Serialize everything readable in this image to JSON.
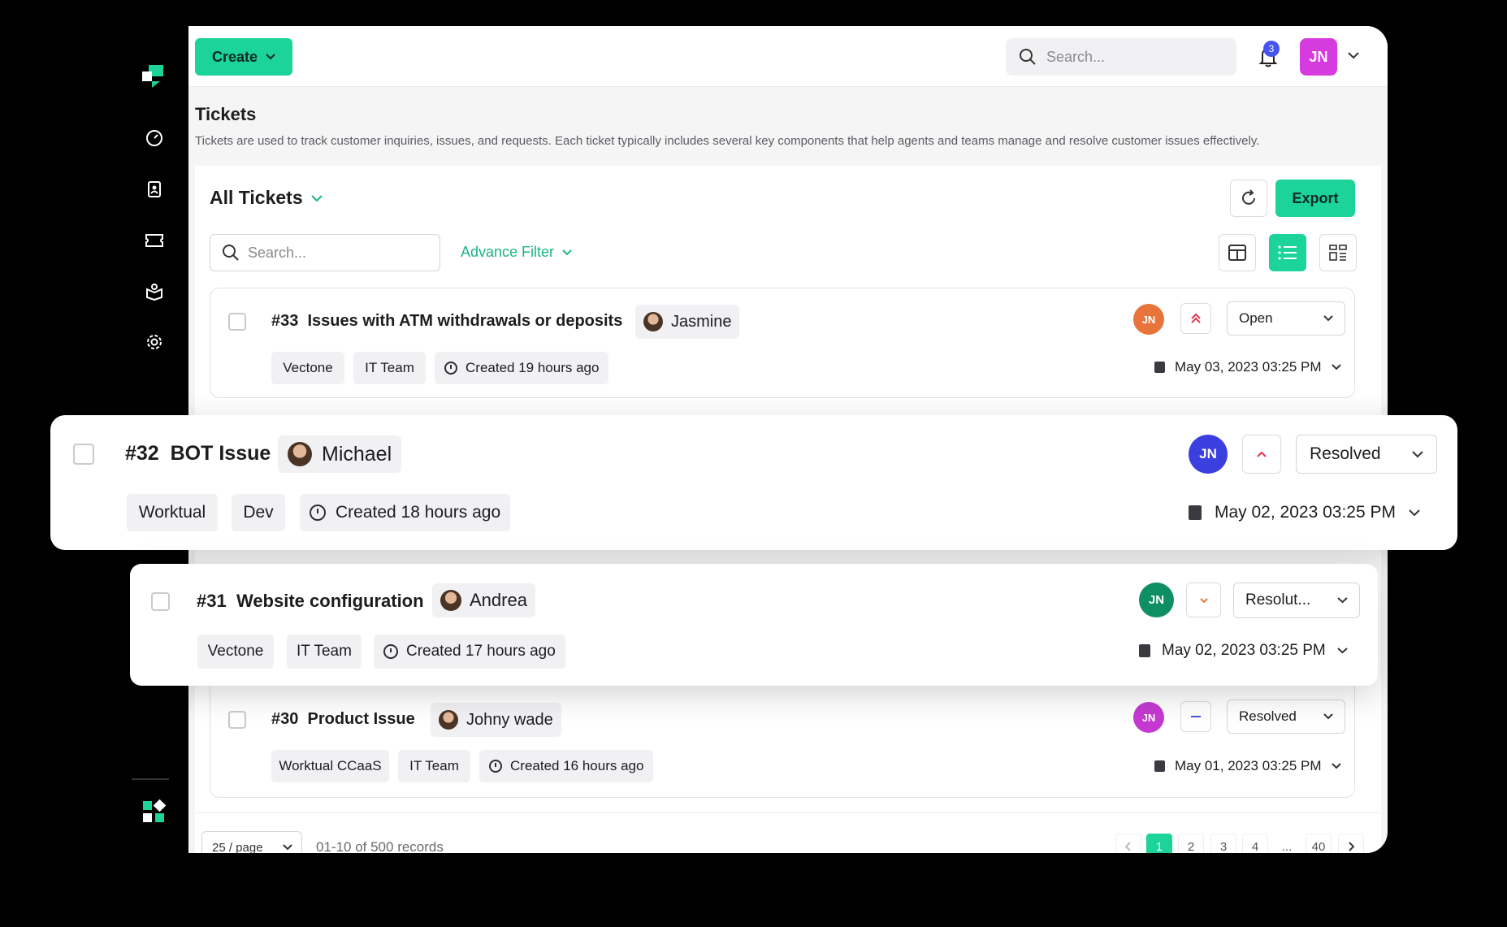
{
  "header": {
    "create_label": "Create",
    "search_placeholder": "Search...",
    "notification_count": "3",
    "user_initials": "JN"
  },
  "page": {
    "title": "Tickets",
    "description": "Tickets are used to track customer inquiries, issues, and requests. Each ticket typically includes several key components that help agents and teams manage and resolve customer issues effectively."
  },
  "toolbar": {
    "view_title": "All Tickets",
    "export_label": "Export",
    "search_placeholder": "Search...",
    "advance_filter_label": "Advance Filter"
  },
  "tickets": [
    {
      "number": "#33",
      "title": "Issues with ATM withdrawals or deposits",
      "assignee": "Jasmine",
      "tags": [
        "Vectone",
        "IT Team"
      ],
      "created": "Created 19 hours ago",
      "agent_initials": "JN",
      "agent_color": "#e8743b",
      "priority": "high",
      "status": "Open",
      "due": "May 03, 2023 03:25 PM"
    },
    {
      "number": "#32",
      "title": "BOT Issue",
      "assignee": "Michael",
      "tags": [
        "Worktual",
        "Dev"
      ],
      "created": "Created 18 hours ago",
      "agent_initials": "JN",
      "agent_color": "#3b3fe0",
      "priority": "medium",
      "status": "Resolved",
      "due": "May 02, 2023 03:25 PM"
    },
    {
      "number": "#31",
      "title": "Website configuration",
      "assignee": "Andrea",
      "tags": [
        "Vectone",
        "IT Team"
      ],
      "created": "Created 17 hours ago",
      "agent_initials": "JN",
      "agent_color": "#0e8e63",
      "priority": "low",
      "status": "Resolut...",
      "due": "May 02, 2023 03:25 PM"
    },
    {
      "number": "#30",
      "title": "Product Issue",
      "assignee": "Johny wade",
      "tags": [
        "Worktual CCaaS",
        "IT Team"
      ],
      "created": "Created 16 hours ago",
      "agent_initials": "JN",
      "agent_color": "#c43ad0",
      "priority": "none",
      "status": "Resolved",
      "due": "May 01, 2023 03:25 PM"
    }
  ],
  "pagination": {
    "page_size": "25 / page",
    "records": "01-10 of 500 records",
    "pages": [
      "1",
      "2",
      "3",
      "4",
      "...",
      "40"
    ],
    "current": "1"
  },
  "colors": {
    "accent": "#1cd39a",
    "priority_high": "#e0344f",
    "priority_low": "#e8743b",
    "priority_none": "#4654ee"
  }
}
